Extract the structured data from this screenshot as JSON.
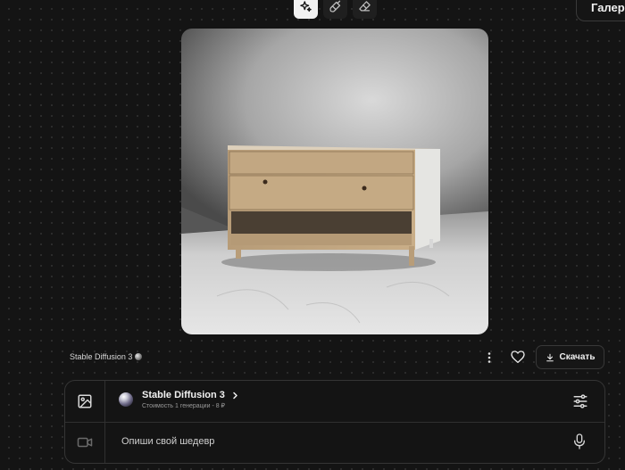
{
  "toolbar": {
    "modes": [
      {
        "icon": "sparkles-icon",
        "active": true
      },
      {
        "icon": "brush-icon",
        "active": false
      },
      {
        "icon": "eraser-icon",
        "active": false
      }
    ],
    "gallery_label": "Галерея"
  },
  "result": {
    "model_label": "Stable Diffusion 3",
    "download_label": "Скачать"
  },
  "composer": {
    "model_name": "Stable Diffusion 3",
    "cost_text": "Стоимость 1 генерации - 8 ₽",
    "prompt_placeholder": "Опиши свой шедевр",
    "prompt_value": ""
  },
  "colors": {
    "background": "#141414",
    "panel_border": "#353535",
    "active_mode": "#f2f2f2"
  }
}
